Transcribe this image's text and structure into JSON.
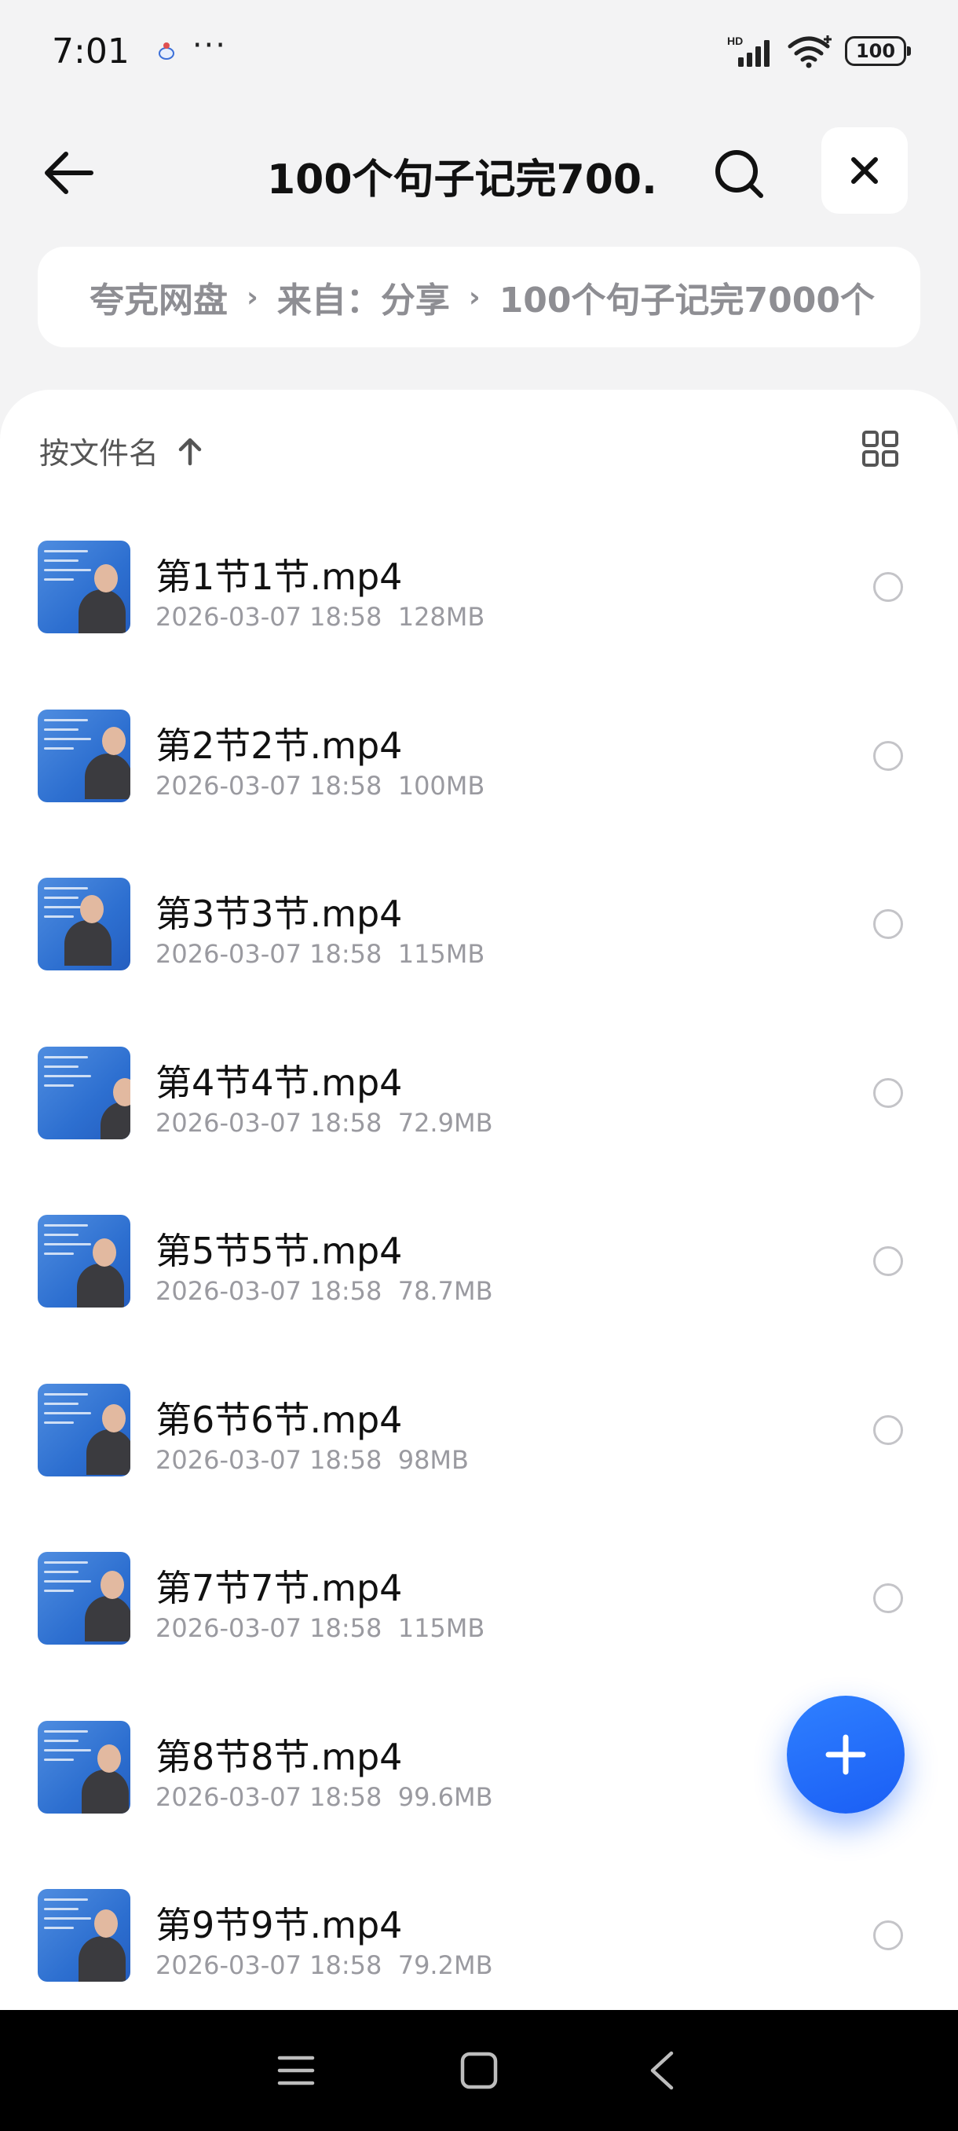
{
  "status_bar": {
    "time": "7:01",
    "more": "···",
    "battery": "100",
    "network": "HD",
    "icons": [
      "app-notification-icon",
      "signal-icon",
      "wifi-icon",
      "battery-icon"
    ]
  },
  "header": {
    "title": "100个句子记完700...",
    "icons": [
      "back-arrow-icon",
      "search-icon",
      "close-icon"
    ]
  },
  "breadcrumb": {
    "items": [
      "夸克网盘",
      "来自：分享",
      "100个句子记完7000个"
    ]
  },
  "list_header": {
    "sort_label": "按文件名",
    "icons": [
      "sort-up-arrow-icon",
      "grid-view-icon"
    ]
  },
  "files": [
    {
      "name": "第1节1节.mp4",
      "date": "2026-03-07 18:58",
      "size": "128MB"
    },
    {
      "name": "第2节2节.mp4",
      "date": "2026-03-07 18:58",
      "size": "100MB"
    },
    {
      "name": "第3节3节.mp4",
      "date": "2026-03-07 18:58",
      "size": "115MB"
    },
    {
      "name": "第4节4节.mp4",
      "date": "2026-03-07 18:58",
      "size": "72.9MB"
    },
    {
      "name": "第5节5节.mp4",
      "date": "2026-03-07 18:58",
      "size": "78.7MB"
    },
    {
      "name": "第6节6节.mp4",
      "date": "2026-03-07 18:58",
      "size": "98MB"
    },
    {
      "name": "第7节7节.mp4",
      "date": "2026-03-07 18:58",
      "size": "115MB"
    },
    {
      "name": "第8节8节.mp4",
      "date": "2026-03-07 18:58",
      "size": "99.6MB"
    },
    {
      "name": "第9节9节.mp4",
      "date": "2026-03-07 18:58",
      "size": "79.2MB"
    }
  ],
  "fab": {
    "icon": "plus-icon"
  },
  "system_nav": {
    "icons": [
      "menu-icon",
      "home-icon",
      "back-icon"
    ]
  },
  "colors": {
    "accent": "#1f6bff",
    "background": "#f3f3f4",
    "muted_text": "#9a9aa0"
  }
}
